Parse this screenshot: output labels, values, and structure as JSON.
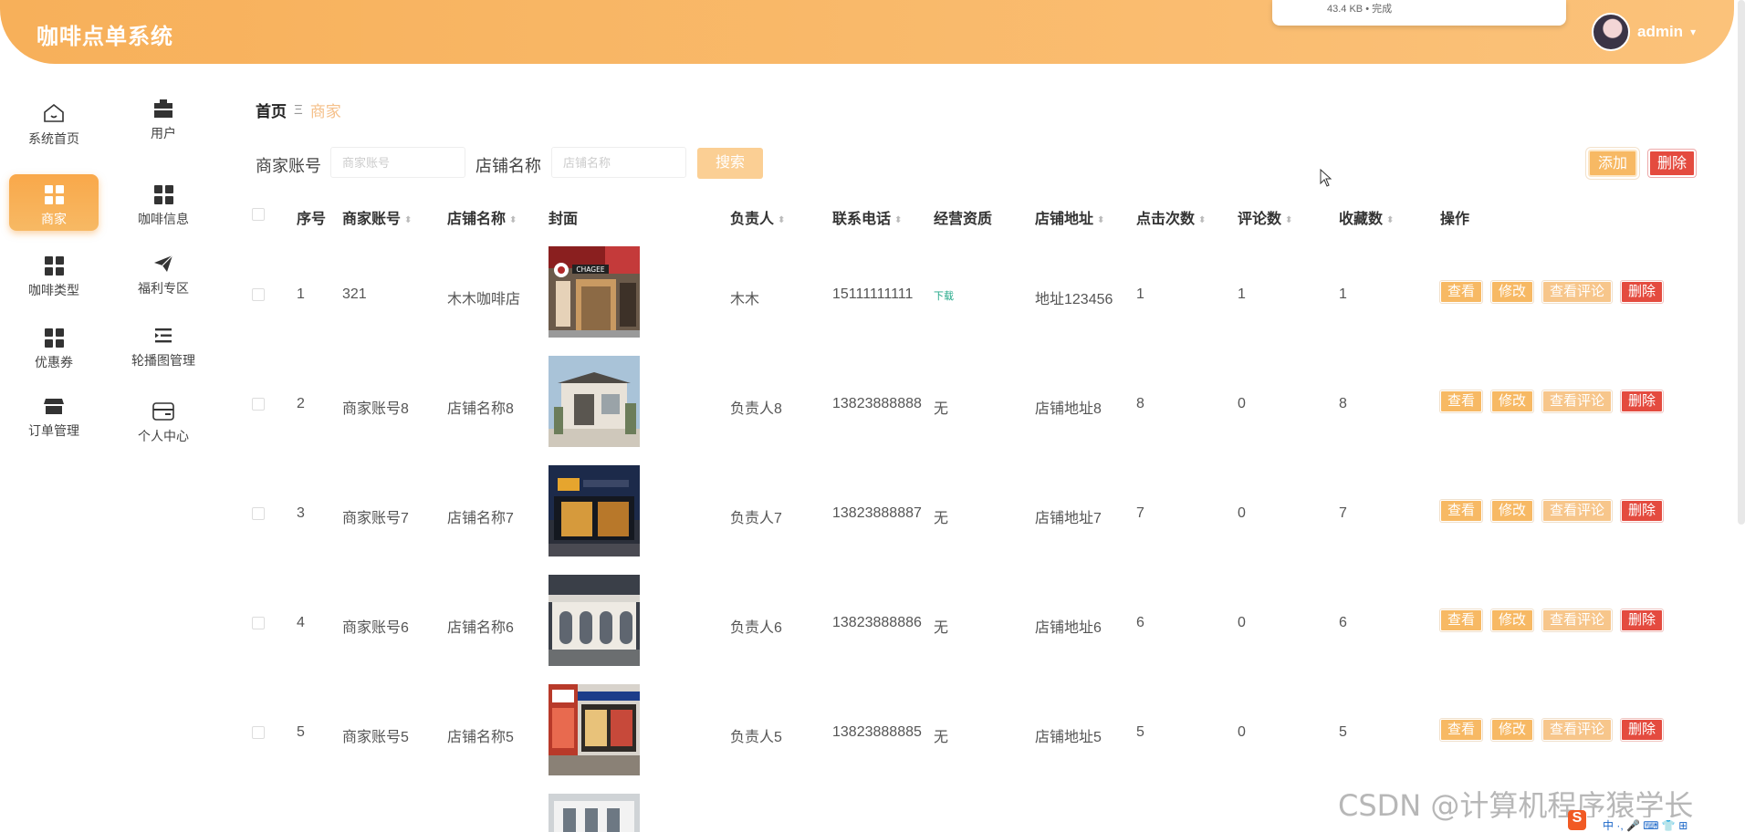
{
  "app": {
    "title": "咖啡点单系统"
  },
  "download": {
    "status": "43.4 KB • 完成"
  },
  "user": {
    "name": "admin",
    "caret": "▾"
  },
  "sidebar": {
    "items": [
      {
        "label": "系统首页",
        "icon": "home-icon"
      },
      {
        "label": "用户",
        "icon": "briefcase-icon"
      },
      {
        "label": "商家",
        "icon": "grid-icon",
        "active": true
      },
      {
        "label": "咖啡信息",
        "icon": "grid-icon"
      },
      {
        "label": "咖啡类型",
        "icon": "grid-icon"
      },
      {
        "label": "福利专区",
        "icon": "paper-plane-icon"
      },
      {
        "label": "优惠券",
        "icon": "grid-icon"
      },
      {
        "label": "轮播图管理",
        "icon": "list-indent-icon"
      },
      {
        "label": "订单管理",
        "icon": "shop-icon"
      },
      {
        "label": "个人中心",
        "icon": "card-icon"
      }
    ]
  },
  "breadcrumb": {
    "home": "首页",
    "separator": "Ξ",
    "current": "商家"
  },
  "search": {
    "account_label": "商家账号",
    "account_placeholder": "商家账号",
    "shop_label": "店铺名称",
    "shop_placeholder": "店铺名称",
    "button": "搜索"
  },
  "toolbar": {
    "add": "添加",
    "delete": "删除"
  },
  "table": {
    "headers": {
      "index": "序号",
      "account": "商家账号",
      "shop": "店铺名称",
      "cover": "封面",
      "owner": "负责人",
      "phone": "联系电话",
      "license": "经营资质",
      "address": "店铺地址",
      "clicks": "点击次数",
      "comments": "评论数",
      "favorites": "收藏数",
      "actions": "操作"
    },
    "sort_icon": "⬍",
    "rows": [
      {
        "index": "1",
        "account": "321",
        "shop": "木木咖啡店",
        "owner": "木木",
        "phone": "15111111111",
        "license": "下载",
        "license_is_link": true,
        "address": "地址123456",
        "clicks": "1",
        "comments": "1",
        "favorites": "1",
        "cover_sign": "CHAGEE"
      },
      {
        "index": "2",
        "account": "商家账号8",
        "shop": "店铺名称8",
        "owner": "负责人8",
        "phone": "13823888888",
        "license": "无",
        "address": "店铺地址8",
        "clicks": "8",
        "comments": "0",
        "favorites": "8"
      },
      {
        "index": "3",
        "account": "商家账号7",
        "shop": "店铺名称7",
        "owner": "负责人7",
        "phone": "13823888887",
        "license": "无",
        "address": "店铺地址7",
        "clicks": "7",
        "comments": "0",
        "favorites": "7"
      },
      {
        "index": "4",
        "account": "商家账号6",
        "shop": "店铺名称6",
        "owner": "负责人6",
        "phone": "13823888886",
        "license": "无",
        "address": "店铺地址6",
        "clicks": "6",
        "comments": "0",
        "favorites": "6"
      },
      {
        "index": "5",
        "account": "商家账号5",
        "shop": "店铺名称5",
        "owner": "负责人5",
        "phone": "13823888885",
        "license": "无",
        "address": "店铺地址5",
        "clicks": "5",
        "comments": "0",
        "favorites": "5"
      }
    ],
    "actions": {
      "view": "查看",
      "edit": "修改",
      "comments": "查看评论",
      "delete": "删除"
    }
  },
  "watermark": "CSDN @计算机程序猿学长",
  "tray": {
    "logo": "S",
    "text": "中 ·, 🎤 ⌨ 👕 ⊞"
  },
  "colors": {
    "accent": "#f7b964",
    "danger": "#e44b3f",
    "header": "#f7b05a",
    "link": "#23a889"
  }
}
